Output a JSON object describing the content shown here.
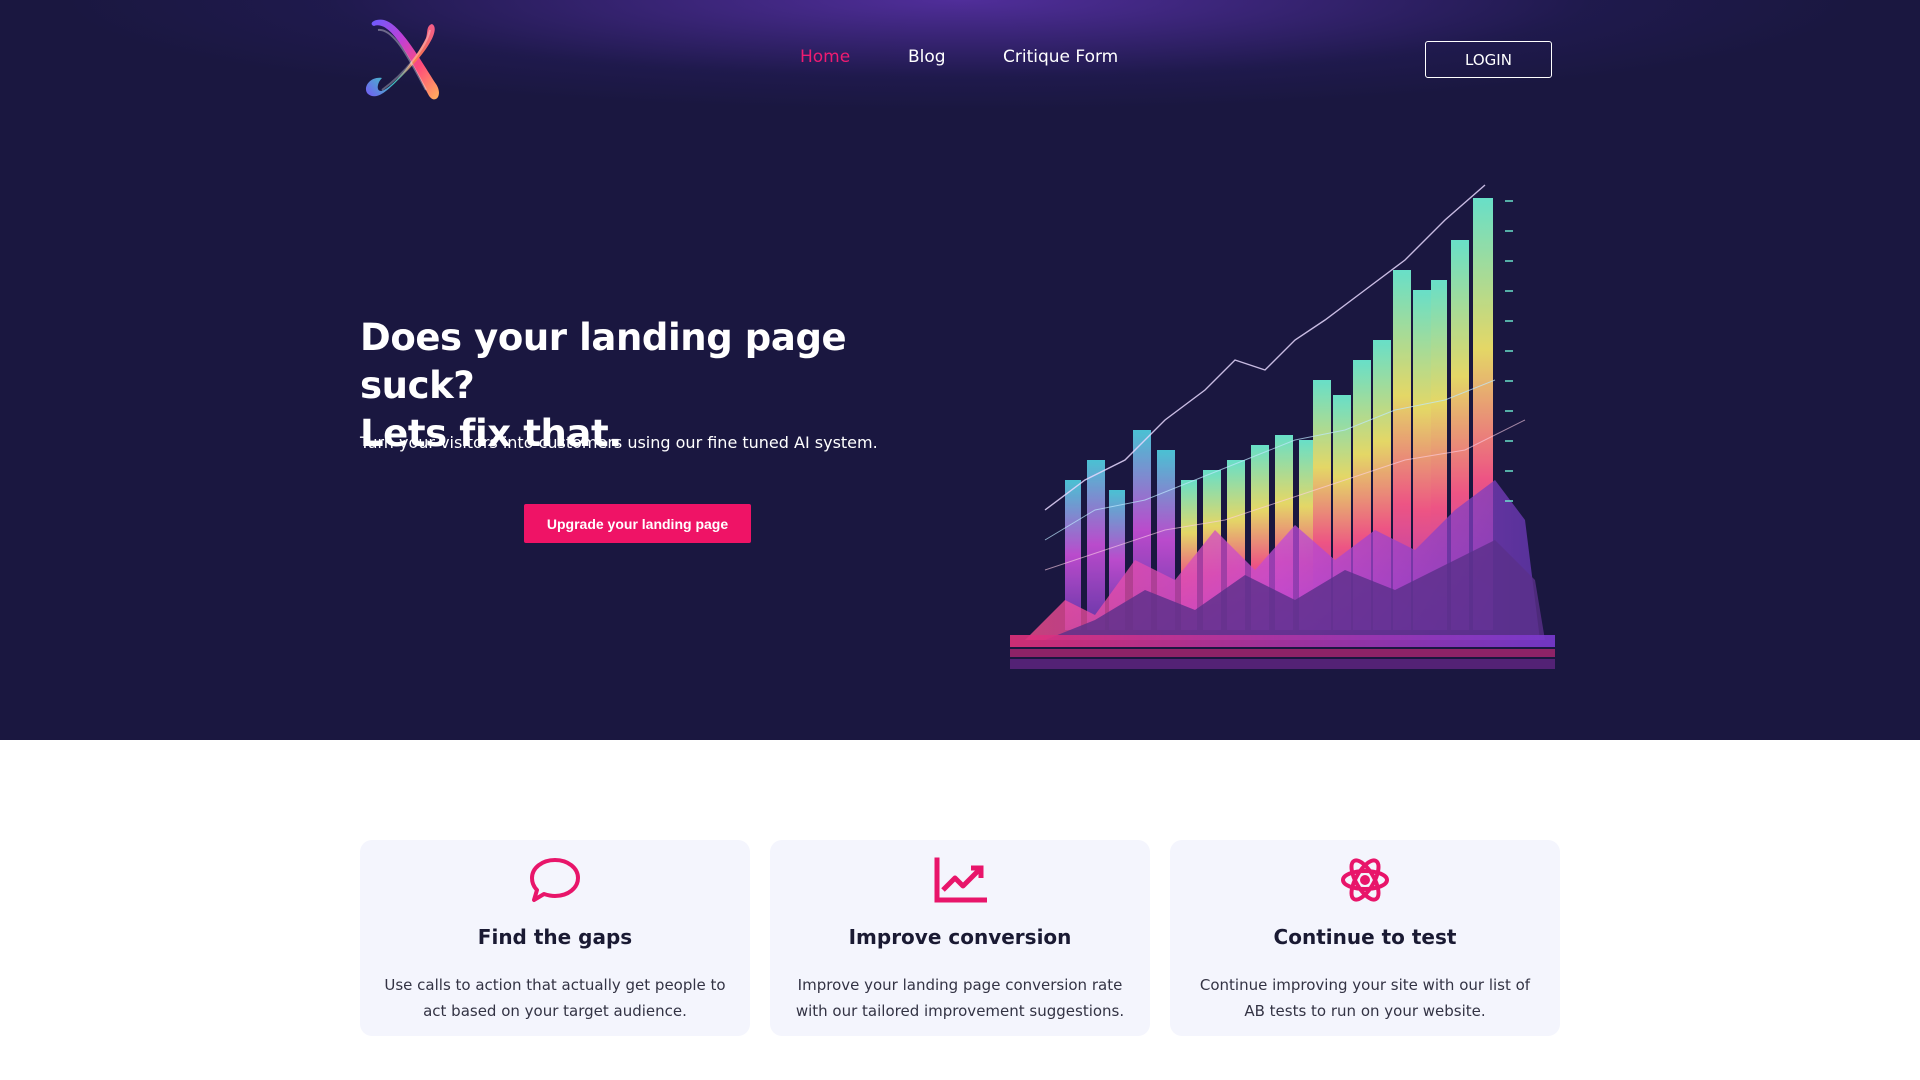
{
  "nav": {
    "links": [
      {
        "label": "Home",
        "active": true
      },
      {
        "label": "Blog",
        "active": false
      },
      {
        "label": "Critique Form",
        "active": false
      }
    ],
    "login_label": "LOGIN"
  },
  "hero": {
    "title_line1": "Does your landing page suck?",
    "title_line2": "Lets fix that.",
    "subtitle": "Turn your visitors into customers using our fine tuned AI system.",
    "cta_label": "Upgrade your landing page"
  },
  "features": [
    {
      "icon": "chat-bubble-icon",
      "title": "Find the gaps",
      "text": "Use calls to action that actually get people to act based on your target audience."
    },
    {
      "icon": "chart-line-icon",
      "title": "Improve conversion",
      "text": "Improve your landing page conversion rate with our tailored improvement suggestions."
    },
    {
      "icon": "atom-icon",
      "title": "Continue to test",
      "text": "Continue improving your site with our list of AB tests to run on your website."
    }
  ],
  "colors": {
    "accent": "#ef1366",
    "hero_bg": "#1a1740",
    "card_bg": "#f4f5fd"
  }
}
